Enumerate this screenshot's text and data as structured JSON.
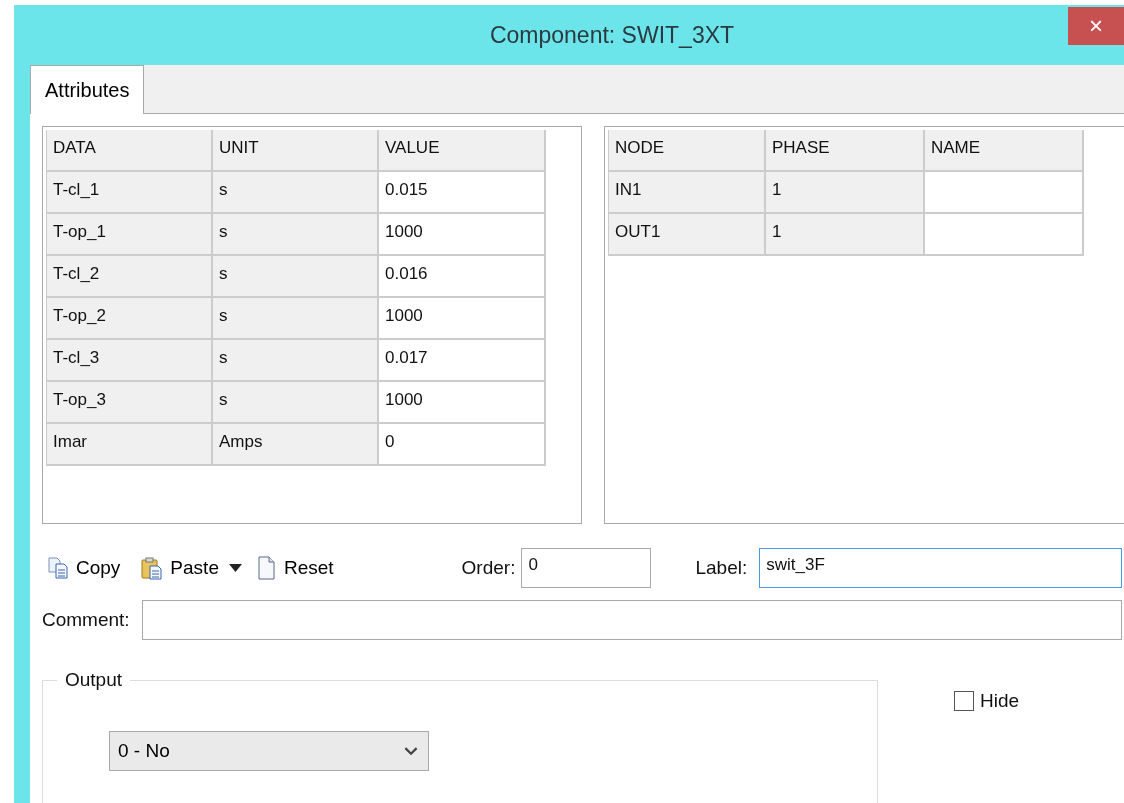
{
  "window": {
    "title": "Component: SWIT_3XT",
    "close": "×"
  },
  "tabs": [
    {
      "label": "Attributes",
      "selected": true
    }
  ],
  "data_table": {
    "columns": [
      "DATA",
      "UNIT",
      "VALUE"
    ],
    "rows": [
      [
        "T-cl_1",
        "s",
        "0.015"
      ],
      [
        "T-op_1",
        "s",
        "1000"
      ],
      [
        "T-cl_2",
        "s",
        "0.016"
      ],
      [
        "T-op_2",
        "s",
        "1000"
      ],
      [
        "T-cl_3",
        "s",
        "0.017"
      ],
      [
        "T-op_3",
        "s",
        "1000"
      ],
      [
        "Imar",
        "Amps",
        "0"
      ]
    ]
  },
  "node_table": {
    "columns": [
      "NODE",
      "PHASE",
      "NAME"
    ],
    "rows": [
      {
        "node": "IN1",
        "phase": "1"
      },
      {
        "node": "OUT1",
        "phase": "1"
      }
    ]
  },
  "toolbar": [
    {
      "kind": "copy",
      "label": "Copy"
    },
    {
      "kind": "paste",
      "label": "Paste",
      "dropdown": true
    },
    {
      "kind": "reset",
      "label": "Reset"
    }
  ],
  "order": {
    "label": "Order:",
    "value": "0",
    "focused": false
  },
  "label_field": {
    "label": "Label:",
    "value": "swit_3F",
    "focused": true
  },
  "comment": {
    "label": "Comment:"
  },
  "output": {
    "title": "Output",
    "value": "0 - No"
  },
  "hide": {
    "label": "Hide",
    "checked": false
  }
}
